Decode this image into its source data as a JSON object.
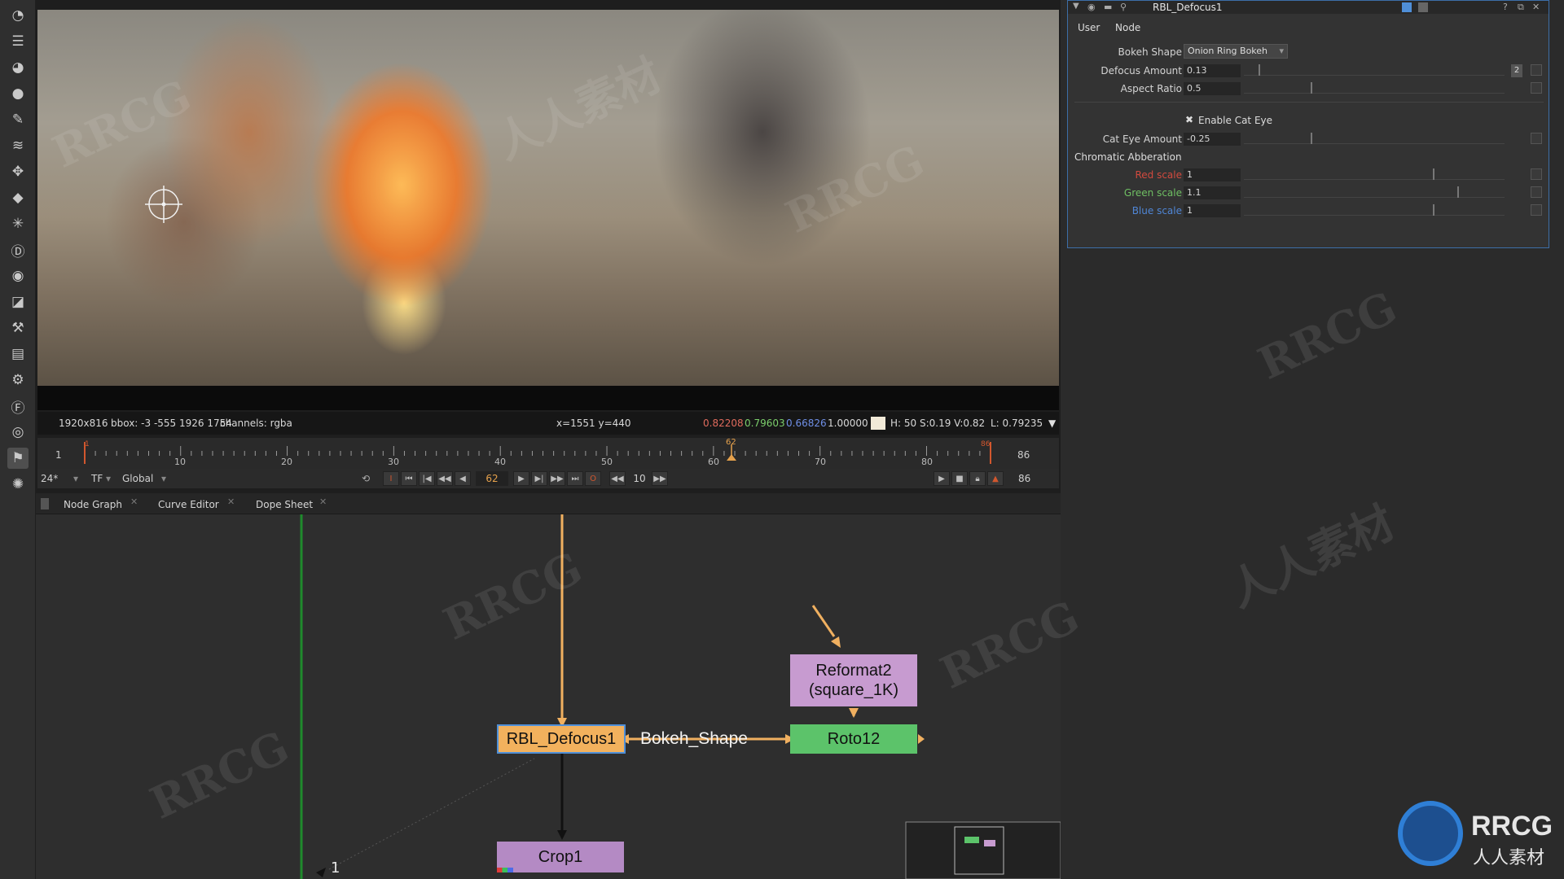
{
  "viewer": {
    "format": "1920x816",
    "bbox": "bbox: -3 -555 1926 1754",
    "channels": "channels: rgba",
    "coords": "x=1551 y=440",
    "r": "0.82208",
    "g": "0.79603",
    "b": "0.66826",
    "a": "1.00000",
    "hsv": "H: 50 S:0.19 V:0.82",
    "lum": "L: 0.79235"
  },
  "timeline": {
    "start_frame": "1",
    "end_frame": "86",
    "ticks": [
      "10",
      "20",
      "30",
      "40",
      "50",
      "60",
      "70",
      "80"
    ],
    "in_marker": "1",
    "out_marker": "86",
    "current_marker": "62"
  },
  "transport": {
    "fps": "24*",
    "tf": "TF",
    "scope": "Global",
    "current_frame": "62",
    "increment": "10",
    "end_frame": "86"
  },
  "tabs": [
    {
      "label": "Node Graph"
    },
    {
      "label": "Curve Editor"
    },
    {
      "label": "Dope Sheet"
    }
  ],
  "nodes": {
    "defocus": "RBL_Defocus1",
    "reformat": "Reformat2\n(square_1K)",
    "roto": "Roto12",
    "crop": "Crop1",
    "link_label": "Bokeh_Shape",
    "pipe_number": "1"
  },
  "properties": {
    "node_name": "RBL_Defocus1",
    "tabs": [
      "User",
      "Node"
    ],
    "bokeh_shape_label": "Bokeh Shape",
    "bokeh_shape_value": "Onion Ring Bokeh",
    "defocus_label": "Defocus Amount",
    "defocus_value": "0.13",
    "defocus_badge": "2",
    "aspect_label": "Aspect Ratio",
    "aspect_value": "0.5",
    "cat_eye_toggle": "Enable Cat Eye",
    "cat_eye_amount_label": "Cat Eye Amount",
    "cat_eye_amount_value": "-0.25",
    "chromatic_label": "Chromatic Abberation",
    "red_label": "Red scale",
    "red_value": "1",
    "green_label": "Green scale",
    "green_value": "1.1",
    "blue_label": "Blue scale",
    "blue_value": "1"
  },
  "watermark": {
    "brand": "RRCG",
    "sub": "人人素材"
  },
  "colors": {
    "defocus_node": "#f2b15d",
    "reformat_node": "#c79bd0",
    "roto_node": "#5cc36a",
    "crop_node": "#b48ac4",
    "pipe_orange": "#f0b060",
    "selection_blue": "#4f8fd8"
  }
}
